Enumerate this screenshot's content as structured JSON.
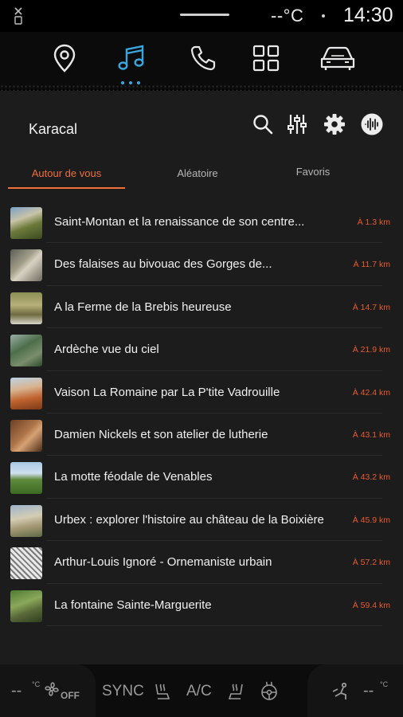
{
  "status_bar": {
    "temperature": "--°C",
    "time": "14:30"
  },
  "top_nav": {
    "items": [
      {
        "icon": "location-pin-icon"
      },
      {
        "icon": "music-icon",
        "active": true
      },
      {
        "icon": "phone-icon"
      },
      {
        "icon": "apps-grid-icon"
      },
      {
        "icon": "car-icon"
      }
    ],
    "accent_color": "#3aa6e0"
  },
  "app": {
    "title": "Karacal",
    "tools": [
      "search-icon",
      "equalizer-icon",
      "settings-icon",
      "audio-source-icon"
    ]
  },
  "tabs": [
    {
      "label": "Autour de vous",
      "active": true
    },
    {
      "label": "Aléatoire"
    },
    {
      "label": "Favoris"
    }
  ],
  "accent_color": "#f0703a",
  "places": [
    {
      "title": "Saint-Montan et la renaissance de son centre...",
      "distance": "À 1.3 km"
    },
    {
      "title": "Des falaises au bivouac des Gorges de...",
      "distance": "À 11.7 km"
    },
    {
      "title": "A la Ferme de la Brebis heureuse",
      "distance": "À 14.7 km"
    },
    {
      "title": "Ardèche vue du ciel",
      "distance": "À 21.9 km"
    },
    {
      "title": "Vaison La Romaine par La P'tite Vadrouille",
      "distance": "À 42.4 km"
    },
    {
      "title": "Damien Nickels et son atelier de lutherie",
      "distance": "À 43.1 km"
    },
    {
      "title": "La motte féodale de Venables",
      "distance": "À 43.2 km"
    },
    {
      "title": "Urbex : explorer l'histoire au château de la Boixière",
      "distance": "À 45.9 km"
    },
    {
      "title": "Arthur-Louis Ignoré - Ornemaniste urbain",
      "distance": "À 57.2 km"
    },
    {
      "title": "La fontaine Sainte-Marguerite",
      "distance": "À 59.4 km"
    }
  ],
  "climate": {
    "left_temp": "--",
    "left_unit": "°C",
    "fan_state": "OFF",
    "sync_label": "SYNC",
    "ac_label": "A/C",
    "right_temp": "--",
    "right_unit": "°C"
  }
}
